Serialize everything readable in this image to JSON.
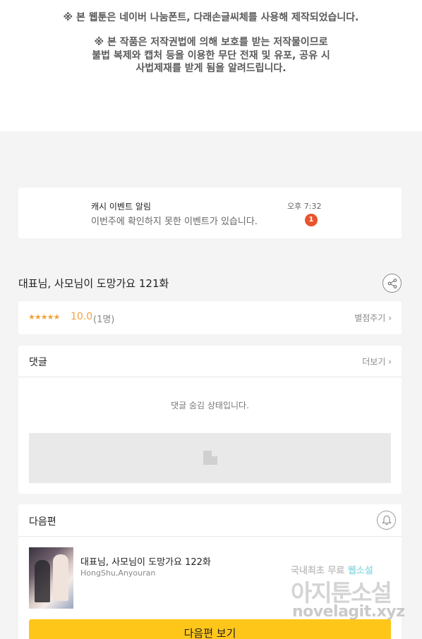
{
  "notice": {
    "line1": "※ 본 웹툰은 네이버 나눔폰트, 다래손글씨체를 사용해 제작되었습니다.",
    "line2": "※ 본 작품은 저작권법에 의해 보호를 받는 저작물이므로",
    "line3": "불법 복제와 캡처 등을 이용한 무단 전재 및 유포, 공유 시",
    "line4": "사법제재를 받게 됨을 알려드립니다."
  },
  "event": {
    "title": "캐시 이벤트 알림",
    "message": "이번주에 확인하지 못한 이벤트가 있습니다.",
    "time": "오후 7:32",
    "badge_count": "1"
  },
  "episode": {
    "title": "대표님, 사모님이 도망가요 121화",
    "share_icon": "share-icon"
  },
  "rating": {
    "stars": "★★★★★",
    "score": "10.0",
    "count": "(1명)",
    "rate_label": "별점주기",
    "star_color": "#f2a33a"
  },
  "comments": {
    "label": "댓글",
    "more_label": "더보기",
    "hidden_message": "댓글 숨김 상태입니다."
  },
  "next_episode": {
    "label": "다음편",
    "bell_icon": "bell-icon",
    "title": "대표님, 사모님이 도망가요 122화",
    "author": "HongShu,Anyouran",
    "button_label": "다음편 보기",
    "button_color": "#ffc61a"
  },
  "watermark": {
    "line1_prefix": "국내최초 무료 ",
    "line1_highlight": "웹소설",
    "line2": "아지툰소설",
    "line3": "novelagit.xyz"
  }
}
